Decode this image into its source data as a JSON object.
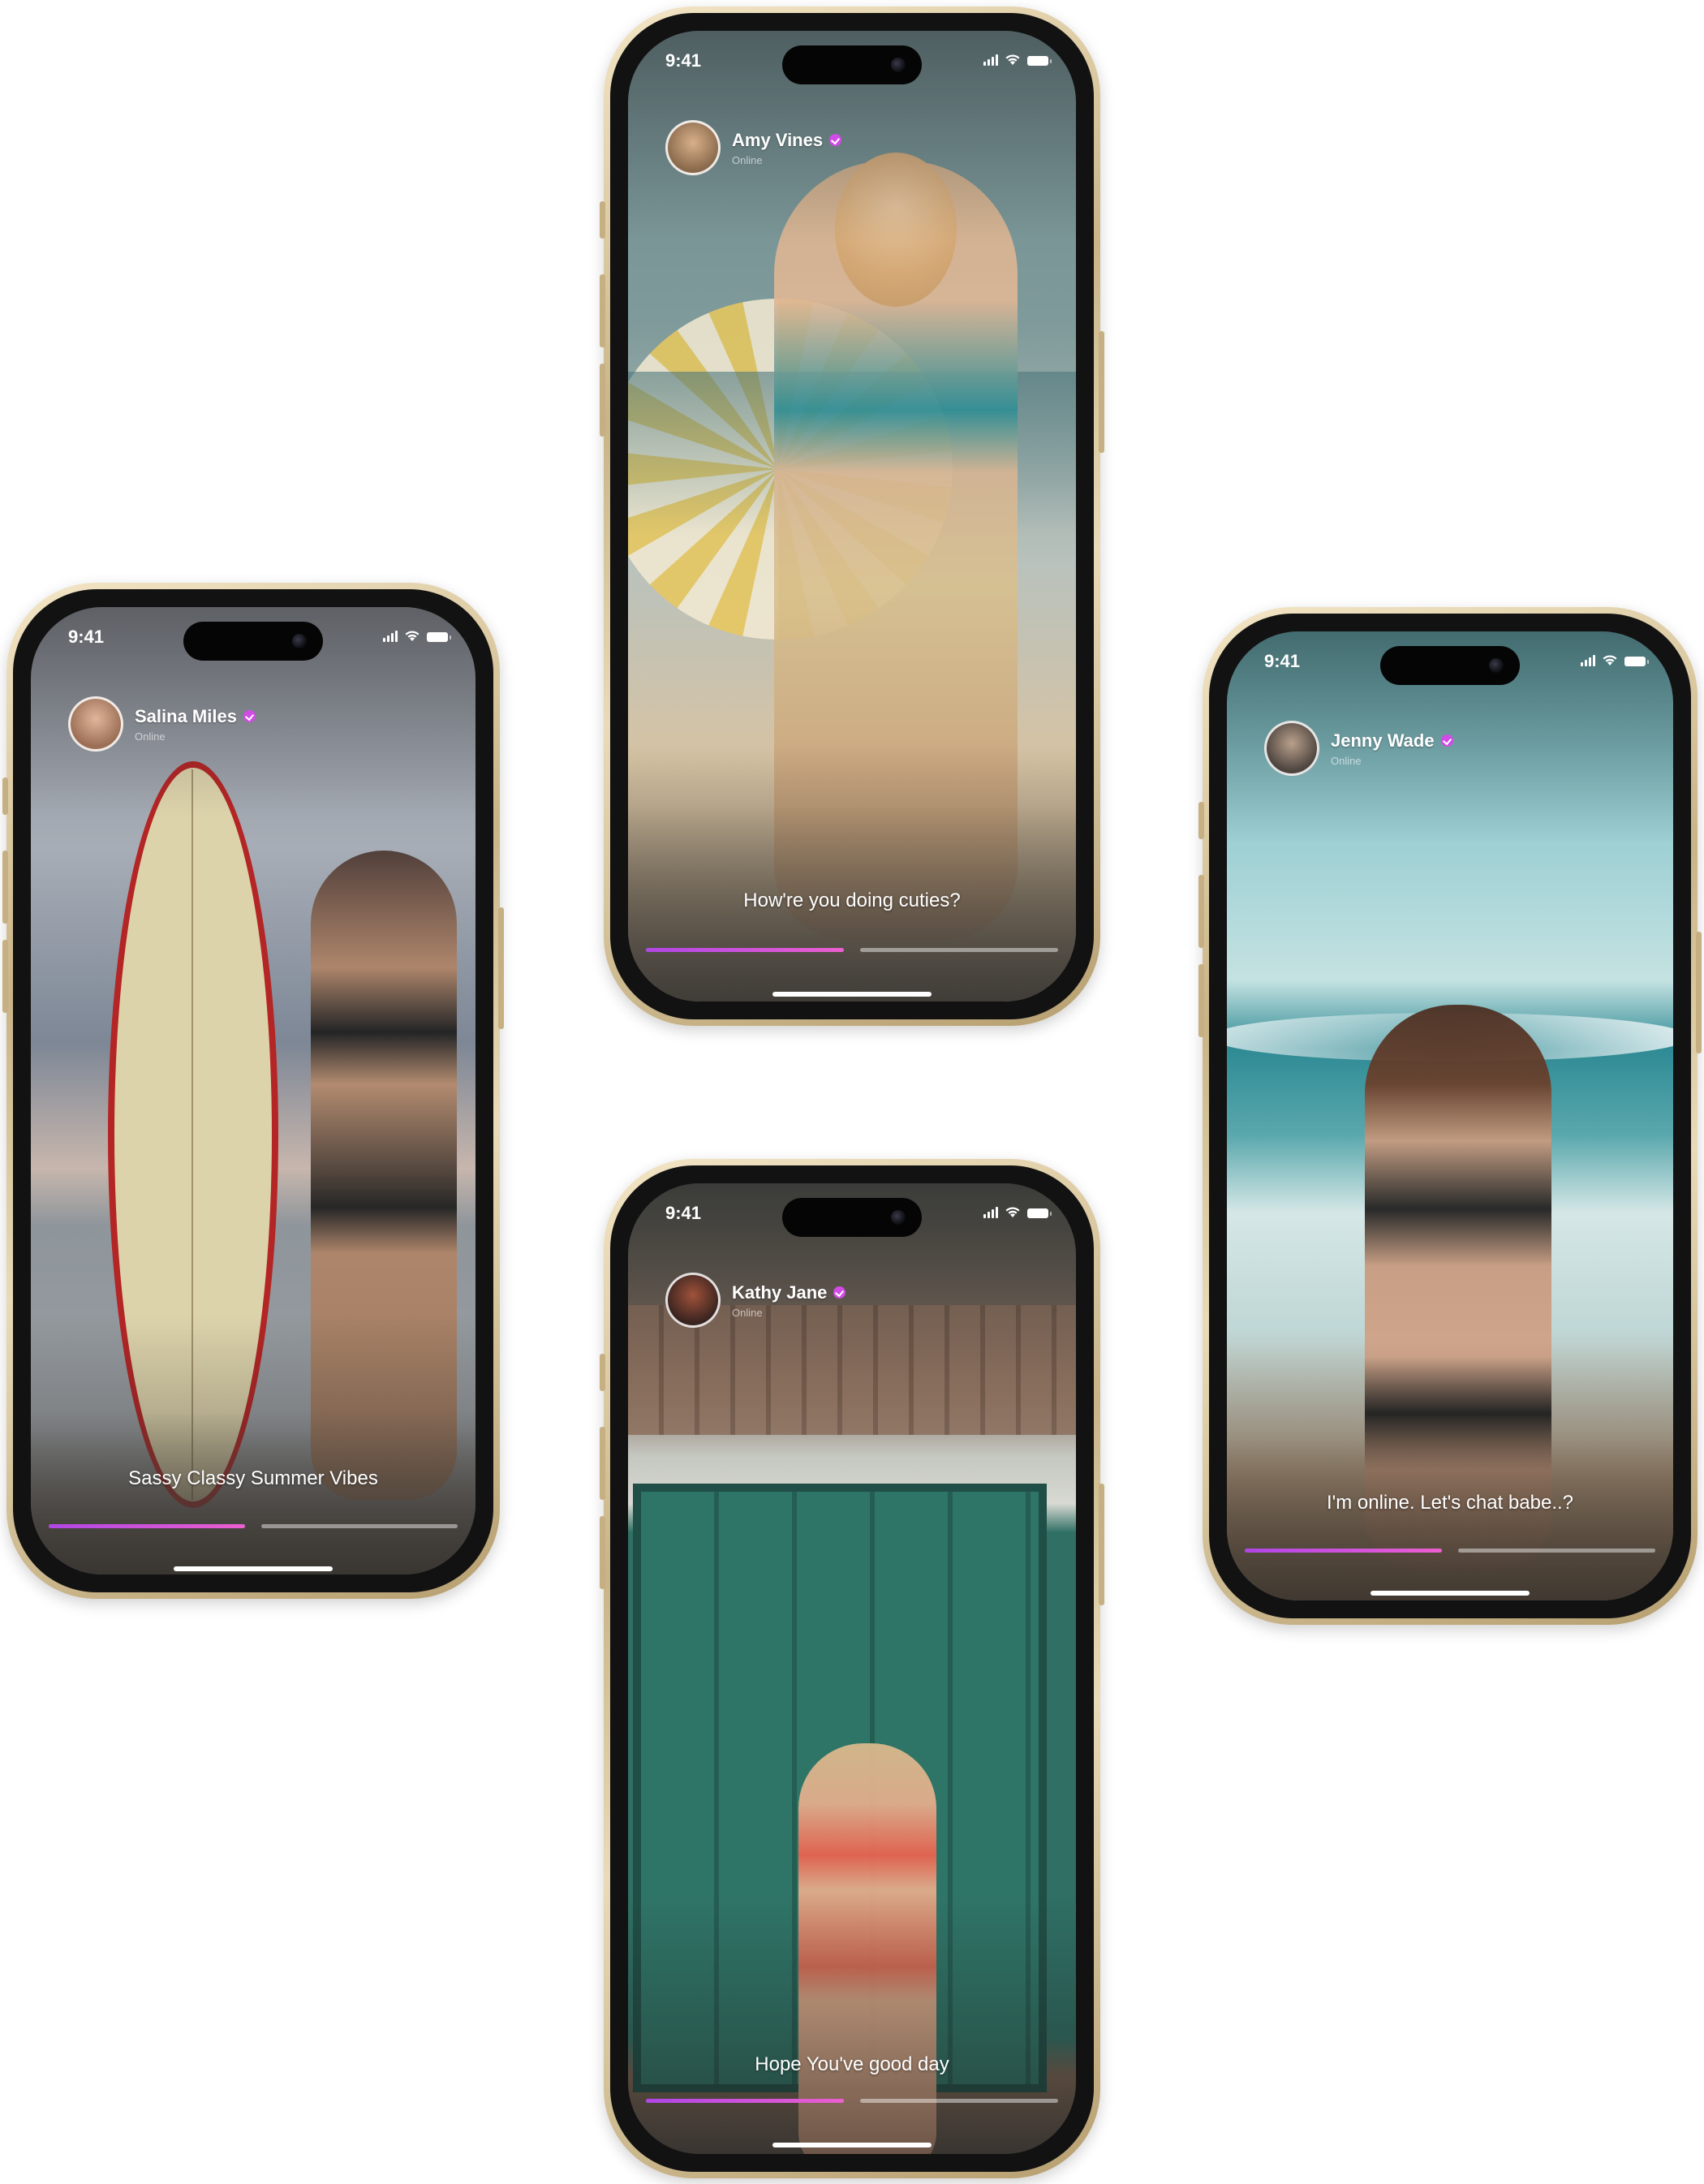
{
  "phones": [
    {
      "id": "amy",
      "time": "9:41",
      "name": "Amy Vines",
      "presence": "Online",
      "caption": "How're you doing cuties?",
      "progress": [
        1.0,
        0.0
      ]
    },
    {
      "id": "salina",
      "time": "9:41",
      "name": "Salina Miles",
      "presence": "Online",
      "caption": "Sassy Classy Summer Vibes",
      "progress": [
        1.0,
        0.0
      ]
    },
    {
      "id": "jenny",
      "time": "9:41",
      "name": "Jenny Wade",
      "presence": "Online",
      "caption": "I'm online. Let's chat babe..?",
      "progress": [
        1.0,
        0.0
      ]
    },
    {
      "id": "kathy",
      "time": "9:41",
      "name": "Kathy Jane",
      "presence": "Online",
      "caption": "Hope You've good day",
      "progress": [
        1.0,
        0.0
      ]
    }
  ],
  "colors": {
    "accent": "#d24be8",
    "progress_gradient_start": "#b046e6",
    "progress_gradient_end": "#ec5fcf",
    "frame_gold": "#c9b487"
  },
  "icons": [
    "signal-icon",
    "wifi-icon",
    "battery-icon",
    "verified-icon"
  ]
}
